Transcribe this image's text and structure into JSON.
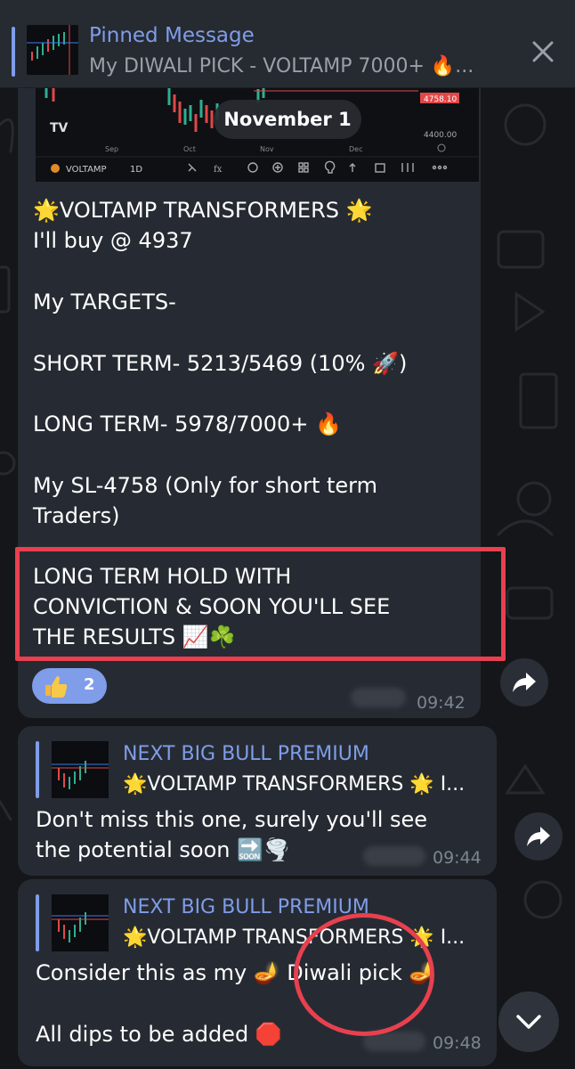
{
  "pinned": {
    "title": "Pinned Message",
    "preview": "My DIWALI PICK - VOLTAMP 7000+ 🔥..."
  },
  "chart": {
    "months": [
      "Sep",
      "Oct",
      "Nov",
      "Dec"
    ],
    "price_labels": [
      "4758.10",
      "4400.00"
    ],
    "symbol": "VOLTAMP",
    "interval": "1D"
  },
  "date_pill": "November 1",
  "message1": {
    "lines": [
      "🌟VOLTAMP TRANSFORMERS 🌟",
      "I'll buy @ 4937",
      "My TARGETS-",
      "SHORT TERM- 5213/5469 (10% 🚀)",
      "LONG TERM- 5978/7000+ 🔥",
      "My SL-4758 (Only for short term",
      "Traders)",
      "LONG TERM HOLD WITH",
      "CONVICTION & SOON YOU'LL SEE",
      "THE RESULTS 📈☘️"
    ],
    "reaction_count": "2",
    "time": "09:42"
  },
  "message2": {
    "reply_title": "NEXT BIG BULL PREMIUM",
    "reply_preview": "🌟VOLTAMP TRANSFORMERS 🌟 I...",
    "lines": [
      "Don't miss this one, surely you'll see",
      "the potential soon 🔜🌪️"
    ],
    "time": "09:44"
  },
  "message3": {
    "reply_title": "NEXT BIG BULL PREMIUM",
    "reply_preview": "🌟VOLTAMP TRANSFORMERS 🌟 I...",
    "lines": [
      "Consider this as my 🪔 Diwali pick 🪔",
      "All dips to be added 🛑"
    ],
    "time": "09:48"
  },
  "colors": {
    "accent": "#7f9de8",
    "bubble": "#262b33",
    "annotation": "#e8404f",
    "background": "#141619"
  }
}
